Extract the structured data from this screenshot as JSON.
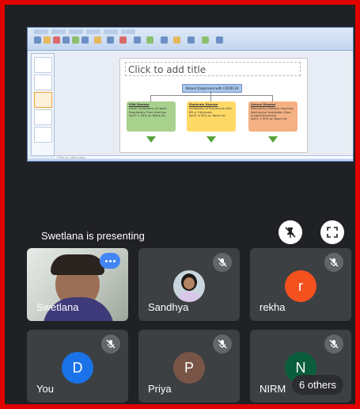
{
  "presentation": {
    "presenter_text": "Swetlana is presenting",
    "slide": {
      "title_placeholder": "Click to add title",
      "root_box": "Patient Diagnosed with COVID-19",
      "cards": [
        {
          "heading": "Mild Disease",
          "lines": [
            "Fever/ Symptoms of Upper Respiratory Tract Infection",
            "SpO2 > 94% on Room Air"
          ],
          "color": "#a9d18e"
        },
        {
          "heading": "Moderate Disease",
          "lines": [
            "Symptoms of Pneumonia with RR ≥ 24/minute",
            "SpO2 ≤ 94% on Room Air"
          ],
          "color": "#ffd966"
        },
        {
          "heading": "Severe Disease",
          "lines": [
            "Respiratory Distress requiring Mechanical Ventilation (Non-Invasive/Invasive)",
            "SpO2 < 90% on Room Air"
          ],
          "color": "#f4b183"
        }
      ],
      "notes_placeholder": "Click to add notes"
    }
  },
  "participants": [
    {
      "name": "Swetlana",
      "type": "video"
    },
    {
      "name": "Sandhya",
      "type": "photo"
    },
    {
      "name": "rekha",
      "initial": "r",
      "avatar_color": "#f4511e"
    },
    {
      "name": "You",
      "initial": "D",
      "avatar_color": "#1a73e8"
    },
    {
      "name": "Priya",
      "initial": "P",
      "avatar_color": "#795548"
    },
    {
      "name": "NIRM",
      "initial": "N",
      "avatar_color": "#0b5e3d"
    }
  ],
  "overflow": {
    "label": "6 others"
  },
  "colors": {
    "frame": "#e00000",
    "background": "#202124",
    "tile": "#3c4043"
  }
}
